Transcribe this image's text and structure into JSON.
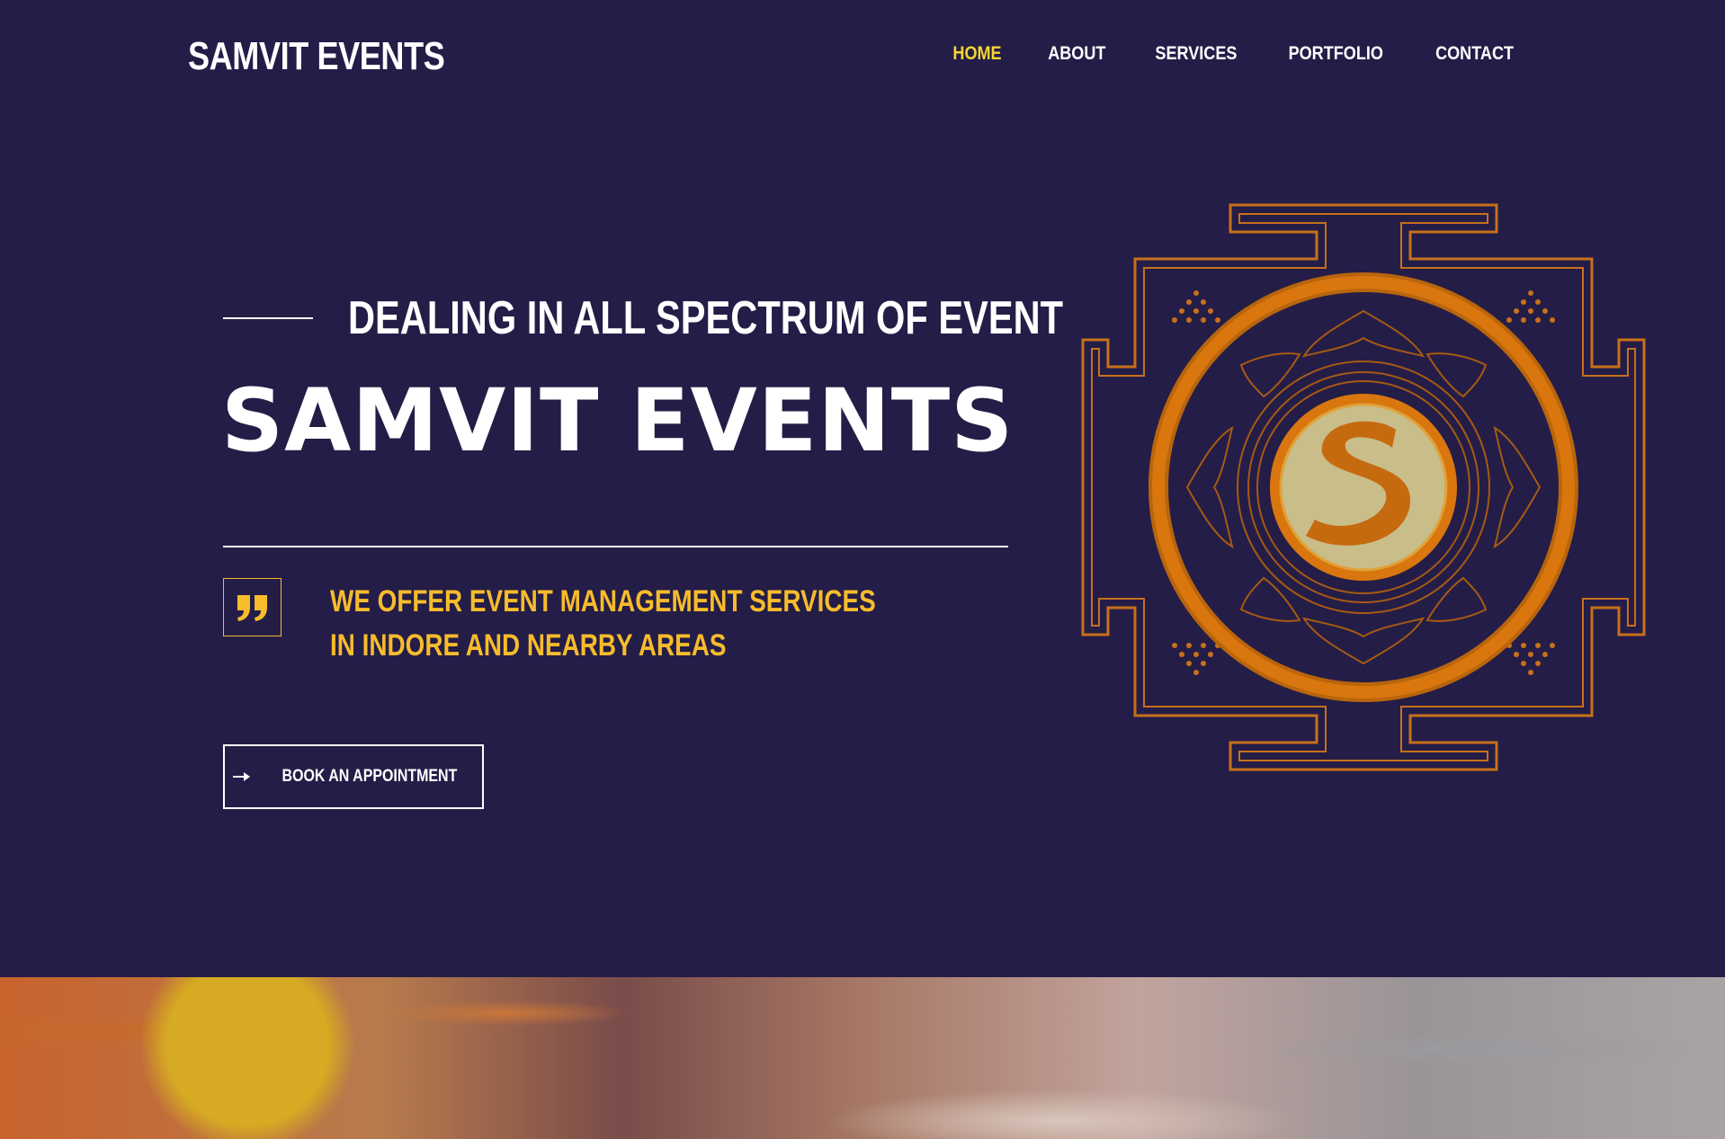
{
  "header": {
    "brand": "SAMVIT EVENTS",
    "nav": [
      {
        "label": "HOME",
        "active": true
      },
      {
        "label": "ABOUT",
        "active": false
      },
      {
        "label": "SERVICES",
        "active": false
      },
      {
        "label": "PORTFOLIO",
        "active": false
      },
      {
        "label": "CONTACT",
        "active": false
      }
    ]
  },
  "hero": {
    "kicker": "DEALING IN ALL SPECTRUM OF EVENT",
    "title": "SAMVIT EVENTS",
    "tagline": "WE OFFER EVENT MANAGEMENT SERVICES IN INDORE AND NEARBY AREAS",
    "cta_label": "BOOK AN APPOINTMENT",
    "cta_icon": "arrow-right-icon",
    "quote_icon": "quote-icon",
    "logo_letter": "S"
  },
  "colors": {
    "background": "#241d47",
    "accent_yellow": "#f4d532",
    "tagline_gold": "#f7bc2c",
    "emblem_orange": "#d9760e"
  }
}
